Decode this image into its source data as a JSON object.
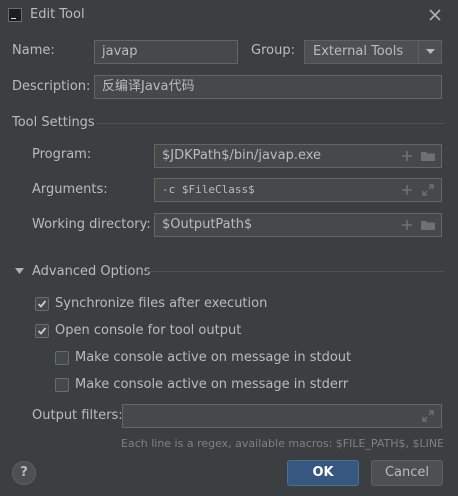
{
  "window": {
    "title": "Edit Tool"
  },
  "name": {
    "label": "Name:",
    "value": "javap"
  },
  "group": {
    "label": "Group:",
    "value": "External Tools"
  },
  "description": {
    "label": "Description:",
    "value": "反编译Java代码"
  },
  "tool_settings": {
    "title": "Tool Settings",
    "program": {
      "label": "Program:",
      "value": "$JDKPath$/bin/javap.exe"
    },
    "arguments": {
      "label": "Arguments:",
      "value": "-c $FileClass$"
    },
    "working_directory": {
      "label": "Working directory:",
      "value": "$OutputPath$"
    }
  },
  "advanced": {
    "title": "Advanced Options",
    "options": [
      {
        "label": "Synchronize files after execution",
        "checked": true
      },
      {
        "label": "Open console for tool output",
        "checked": true
      },
      {
        "label": "Make console active on message in stdout",
        "checked": false
      },
      {
        "label": "Make console active on message in stderr",
        "checked": false
      }
    ],
    "output_filters": {
      "label": "Output filters:",
      "value": "",
      "hint": "Each line is a regex, available macros: $FILE_PATH$, $LINE$ ..."
    }
  },
  "buttons": {
    "help": "?",
    "ok": "OK",
    "cancel": "Cancel"
  },
  "colors": {
    "background": "#3c3f41",
    "field": "#45494a",
    "accent": "#365880",
    "checkmark": "#c8c8c8"
  },
  "icons": [
    "close-icon",
    "plus-icon",
    "folder-icon",
    "expand-icon",
    "dropdown-arrow-icon",
    "triangle-down-icon",
    "checkmark-icon"
  ]
}
